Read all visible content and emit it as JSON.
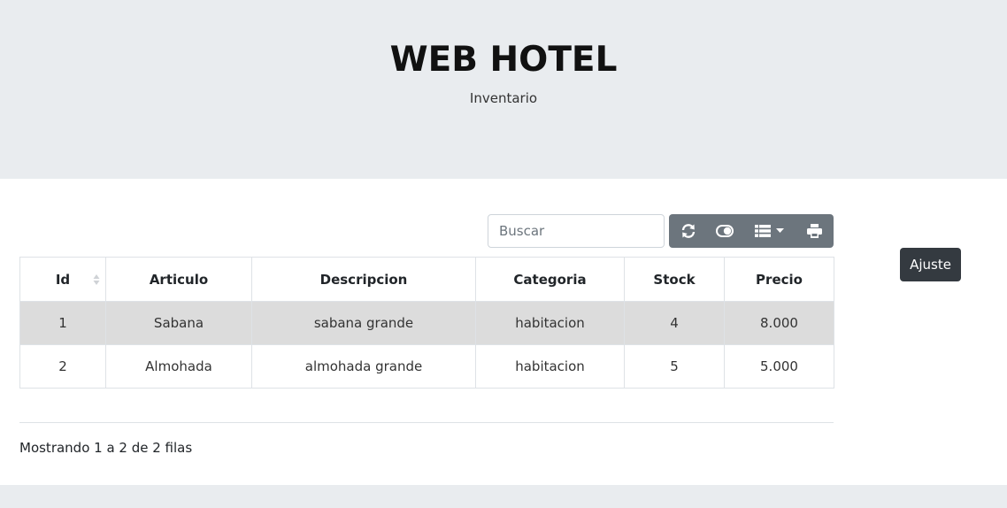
{
  "header": {
    "title": "WEB HOTEL",
    "subtitle": "Inventario"
  },
  "toolbar": {
    "search_placeholder": "Buscar",
    "buttons": [
      {
        "icon": "refresh-icon"
      },
      {
        "icon": "toggle-icon"
      },
      {
        "icon": "columns-icon"
      },
      {
        "icon": "print-icon"
      }
    ],
    "button_color": "#6c757d"
  },
  "table": {
    "columns": [
      "Id",
      "Articulo",
      "Descripcion",
      "Categoria",
      "Stock",
      "Precio"
    ],
    "rows": [
      [
        "1",
        "Sabana",
        "sabana grande",
        "habitacion",
        "4",
        "8.000"
      ],
      [
        "2",
        "Almohada",
        "almohada grande",
        "habitacion",
        "5",
        "5.000"
      ]
    ]
  },
  "pagination": {
    "info": "Mostrando 1 a 2 de 2 filas"
  },
  "tooltip": {
    "label": "Ajuste"
  }
}
